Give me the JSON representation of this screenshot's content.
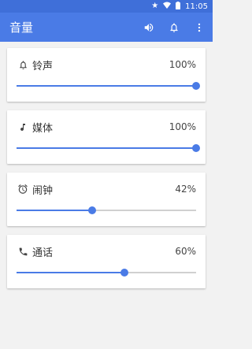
{
  "status_bar": {
    "time": "11:05"
  },
  "app_bar": {
    "title": "音量"
  },
  "volumes": [
    {
      "label": "铃声",
      "percent_text": "100%",
      "level": 1.0,
      "icon": "bell-icon"
    },
    {
      "label": "媒体",
      "percent_text": "100%",
      "level": 1.0,
      "icon": "music-note-icon"
    },
    {
      "label": "闹钟",
      "percent_text": "42%",
      "level": 0.42,
      "icon": "alarm-clock-icon"
    },
    {
      "label": "通话",
      "percent_text": "60%",
      "level": 0.6,
      "icon": "phone-icon"
    }
  ],
  "colors": {
    "accent": "#4a7be6",
    "status_bar": "#3f6fd9",
    "track": "#d0d0d0"
  }
}
